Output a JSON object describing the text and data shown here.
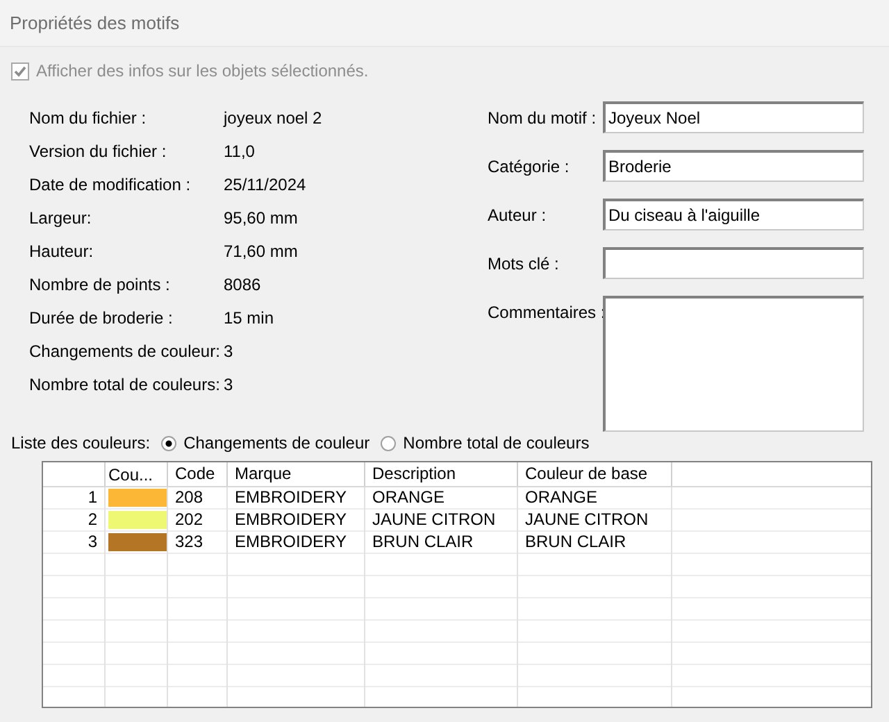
{
  "window": {
    "title": "Propriétés des motifs"
  },
  "show_info": {
    "label": "Afficher des infos sur les objets sélectionnés.",
    "checked": true,
    "disabled": true
  },
  "info": [
    {
      "label": "Nom du fichier :",
      "value": "joyeux noel 2"
    },
    {
      "label": "Version du fichier :",
      "value": "11,0"
    },
    {
      "label": "Date de modification :",
      "value": "25/11/2024"
    },
    {
      "label": "Largeur:",
      "value": "95,60 mm"
    },
    {
      "label": "Hauteur:",
      "value": "71,60 mm"
    },
    {
      "label": "Nombre de points :",
      "value": "8086"
    },
    {
      "label": "Durée de broderie :",
      "value": "15 min"
    },
    {
      "label": "Changements de couleur:",
      "value": "3"
    },
    {
      "label": "Nombre total de couleurs:",
      "value": "3"
    }
  ],
  "fields": [
    {
      "label": "Nom du motif :",
      "value": "Joyeux Noel",
      "kind": "line"
    },
    {
      "label": "Catégorie :",
      "value": "Broderie",
      "kind": "line"
    },
    {
      "label": "Auteur :",
      "value": "Du ciseau à l'aiguille",
      "kind": "line"
    },
    {
      "label": "Mots clé :",
      "kind": "line"
    },
    {
      "label": "Commentaires :",
      "kind": "area"
    }
  ],
  "color_list": {
    "label": "Liste des couleurs:",
    "options": [
      {
        "label": "Changements de couleur",
        "selected": true
      },
      {
        "label": "Nombre total de couleurs",
        "selected": false
      }
    ]
  },
  "table": {
    "columns": [
      "Cou...",
      "Code",
      "Marque",
      "Description",
      "Couleur de base"
    ],
    "rows": [
      {
        "index": "1",
        "color": "#fbb735",
        "code": "208",
        "brand": "EMBROIDERY",
        "description": "ORANGE",
        "base": "ORANGE"
      },
      {
        "index": "2",
        "color": "#eef873",
        "code": "202",
        "brand": "EMBROIDERY",
        "description": "JAUNE CITRON",
        "base": "JAUNE CITRON"
      },
      {
        "index": "3",
        "color": "#b47625",
        "code": "323",
        "brand": "EMBROIDERY",
        "description": "BRUN CLAIR",
        "base": "BRUN CLAIR"
      }
    ]
  }
}
